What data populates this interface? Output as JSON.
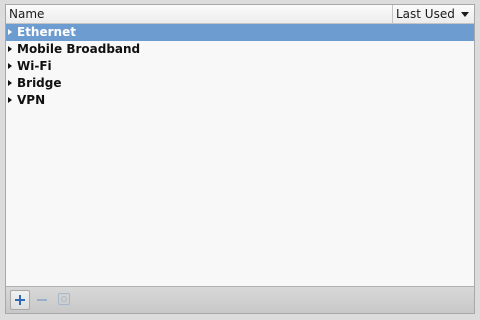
{
  "header": {
    "name_label": "Name",
    "sort_label": "Last Used"
  },
  "connections": [
    {
      "label": "Ethernet",
      "selected": true
    },
    {
      "label": "Mobile Broadband",
      "selected": false
    },
    {
      "label": "Wi-Fi",
      "selected": false
    },
    {
      "label": "Bridge",
      "selected": false
    },
    {
      "label": "VPN",
      "selected": false
    }
  ],
  "toolbar": {
    "add_icon": "plus-icon",
    "remove_icon": "minus-icon",
    "settings_icon": "gear-icon"
  },
  "colors": {
    "selection": "#6d9cd0",
    "add_icon": "#2f6cb5"
  }
}
